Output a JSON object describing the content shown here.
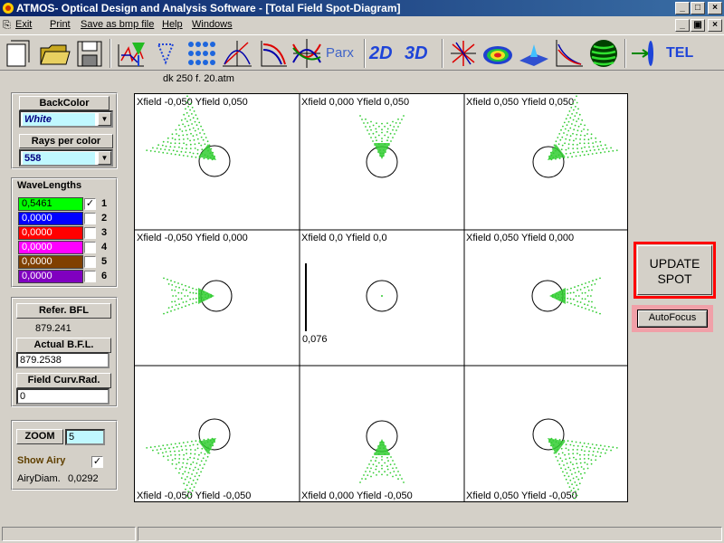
{
  "window": {
    "title": "ATMOS- Optical Design and Analysis Software - [Total Field Spot-Diagram]",
    "min_glyph": "_",
    "max_glyph": "□",
    "close_glyph": "×",
    "restore_glyph": "▣"
  },
  "menu": [
    "Exit",
    "Print",
    "Save as bmp file",
    "Help",
    "Windows"
  ],
  "toolbar": {
    "parx": "Parx",
    "two_d": "2D",
    "three_d": "3D",
    "tel": "TEL"
  },
  "file_label": "dk 250  f. 20.atm",
  "left_panel": {
    "back_color_label": "BackColor",
    "back_color_value": "White",
    "rays_label": "Rays  per color",
    "rays_value": "558",
    "wavelengths_title": "WaveLengths",
    "wavelengths": [
      {
        "value": "0,5461",
        "color": "#00ff00",
        "text_color": "#000000",
        "checked": true,
        "index": "1"
      },
      {
        "value": "0,0000",
        "color": "#0000ff",
        "text_color": "#ffffff",
        "checked": false,
        "index": "2"
      },
      {
        "value": "0,0000",
        "color": "#ff0000",
        "text_color": "#ffffff",
        "checked": false,
        "index": "3"
      },
      {
        "value": "0,0000",
        "color": "#ff00ff",
        "text_color": "#ffffff",
        "checked": false,
        "index": "4"
      },
      {
        "value": "0,0000",
        "color": "#804000",
        "text_color": "#ffffff",
        "checked": false,
        "index": "5"
      },
      {
        "value": "0,0000",
        "color": "#8000c0",
        "text_color": "#ffffff",
        "checked": false,
        "index": "6"
      }
    ],
    "refer_bfl_label": "Refer.  BFL",
    "refer_bfl_value": "879.241",
    "actual_bfl_label": "Actual  B.F.L.",
    "actual_bfl_value": "879.2538",
    "field_curv_label": "Field Curv.Rad.",
    "field_curv_value": "0",
    "zoom_label": "ZOOM",
    "zoom_value": "5",
    "show_airy_label": "Show Airy",
    "show_airy_checked": true,
    "airy_diam_label": "AiryDiam.",
    "airy_diam_value": "0,0292"
  },
  "spot_cells": [
    {
      "label": "Xfield  -0,050  Yfield  0,050"
    },
    {
      "label": "Xfield  0,000  Yfield  0,050"
    },
    {
      "label": "Xfield  0,050  Yfield  0,050"
    },
    {
      "label": "Xfield  -0,050  Yfield  0,000"
    },
    {
      "label": "Xfield  0,0  Yfield  0,0"
    },
    {
      "label": "Xfield  0,050  Yfield  0,000"
    },
    {
      "label": "Xfield  -0,050  Yfield  -0,050"
    },
    {
      "label": "Xfield  0,000  Yfield  -0,050"
    },
    {
      "label": "Xfield  0,050  Yfield  -0,050"
    }
  ],
  "scale_label": "0,076",
  "update_spot_label": "UPDATE SPOT",
  "autofocus_label": "AutoFocus",
  "colors": {
    "spot": "#33cc33",
    "update_border": "#ff0000",
    "autofocus_bg": "#f0a0a8"
  }
}
